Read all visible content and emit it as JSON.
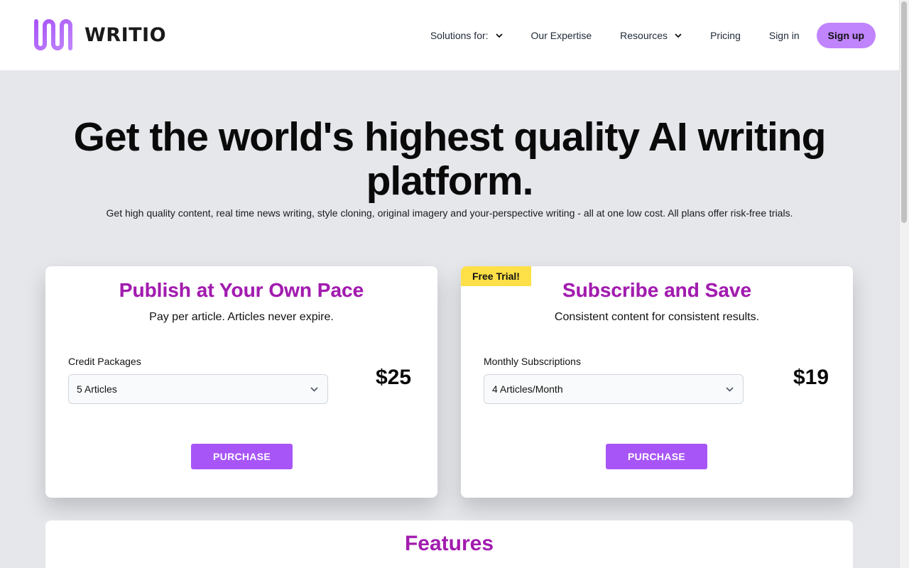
{
  "brand": {
    "name": "WRITIO",
    "color": "#a855f7"
  },
  "nav": {
    "solutions": "Solutions for:",
    "expertise": "Our Expertise",
    "resources": "Resources",
    "pricing": "Pricing",
    "signin": "Sign in",
    "signup": "Sign up"
  },
  "hero": {
    "title": "Get the world's highest quality AI writing platform.",
    "subtitle": "Get high quality content, real time news writing, style cloning, original imagery and your-perspective writing - all at one low cost. All plans offer risk-free trials."
  },
  "plans": [
    {
      "title": "Publish at Your Own Pace",
      "subtitle": "Pay per article. Articles never expire.",
      "field_label": "Credit Packages",
      "selected": "5 Articles",
      "price": "$25",
      "button": "PURCHASE"
    },
    {
      "badge": "Free Trial!",
      "title": "Subscribe and Save",
      "subtitle": "Consistent content for consistent results.",
      "field_label": "Monthly Subscriptions",
      "selected": "4 Articles/Month",
      "price": "$19",
      "button": "PURCHASE"
    }
  ],
  "features": {
    "title": "Features"
  },
  "colors": {
    "accent": "#a855f7",
    "title": "#a21caf",
    "badge": "#fde047",
    "signup": "#c084fc",
    "background": "#e5e7eb"
  },
  "icons": [
    "writio-logo-icon",
    "chevron-down-icon"
  ]
}
